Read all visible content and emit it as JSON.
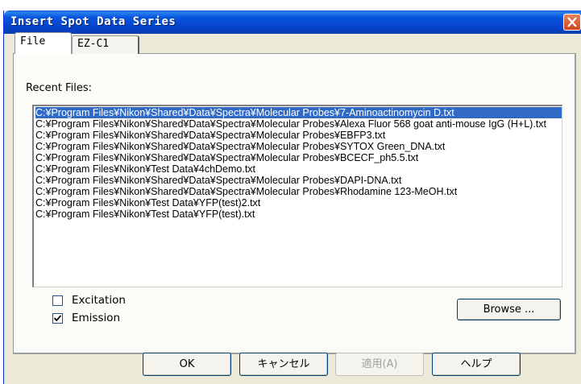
{
  "window": {
    "title": "Insert Spot Data Series"
  },
  "tabs": [
    {
      "label": "File"
    },
    {
      "label": "EZ-C1"
    }
  ],
  "file_tab": {
    "recent_files_label": "Recent Files:",
    "recent_files": [
      "C:¥Program Files¥Nikon¥Shared¥Data¥Spectra¥Molecular Probes¥7-Aminoactinomycin D.txt",
      "C:¥Program Files¥Nikon¥Shared¥Data¥Spectra¥Molecular Probes¥Alexa Fluor 568 goat anti-mouse IgG (H+L).txt",
      "C:¥Program Files¥Nikon¥Shared¥Data¥Spectra¥Molecular Probes¥EBFP3.txt",
      "C:¥Program Files¥Nikon¥Shared¥Data¥Spectra¥Molecular Probes¥SYTOX Green_DNA.txt",
      "C:¥Program Files¥Nikon¥Shared¥Data¥Spectra¥Molecular Probes¥BCECF_ph5.5.txt",
      "C:¥Program Files¥Nikon¥Test Data¥4chDemo.txt",
      "C:¥Program Files¥Nikon¥Shared¥Data¥Spectra¥Molecular Probes¥DAPI-DNA.txt",
      "C:¥Program Files¥Nikon¥Shared¥Data¥Spectra¥Molecular Probes¥Rhodamine 123-MeOH.txt",
      "C:¥Program Files¥Nikon¥Test Data¥YFP(test)2.txt",
      "C:¥Program Files¥Nikon¥Test Data¥YFP(test).txt"
    ],
    "excitation": {
      "label": "Excitation",
      "checked": false
    },
    "emission": {
      "label": "Emission",
      "checked": true
    },
    "browse_label": "Browse ..."
  },
  "footer": {
    "ok_label": "OK",
    "cancel_label": "キャンセル",
    "apply_label": "適用(A)",
    "help_label": "ヘルプ"
  },
  "colors": {
    "selection": "#316ac5",
    "titlebar": "#0855dd",
    "dialog_bg": "#ece9d8",
    "close_button": "#d0451e"
  },
  "icons": {
    "close": "close-icon",
    "check": "checkmark-icon"
  }
}
